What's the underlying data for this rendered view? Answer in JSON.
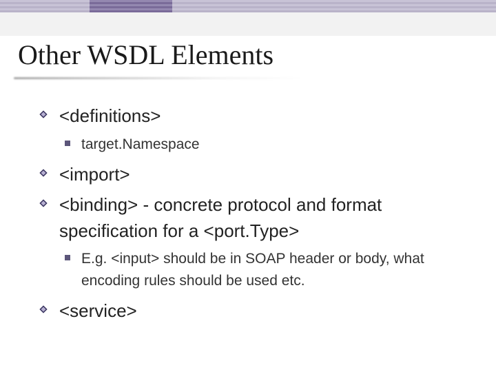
{
  "title": "Other WSDL Elements",
  "bullets": {
    "b1": "<definitions>",
    "b1_sub1": "target.Namespace",
    "b2": "<import>",
    "b3": "<binding> - concrete protocol and format specification for a <port.Type>",
    "b3_sub1": "E.g. <input> should be in SOAP header or body, what encoding rules should be used etc.",
    "b4": "<service>"
  }
}
